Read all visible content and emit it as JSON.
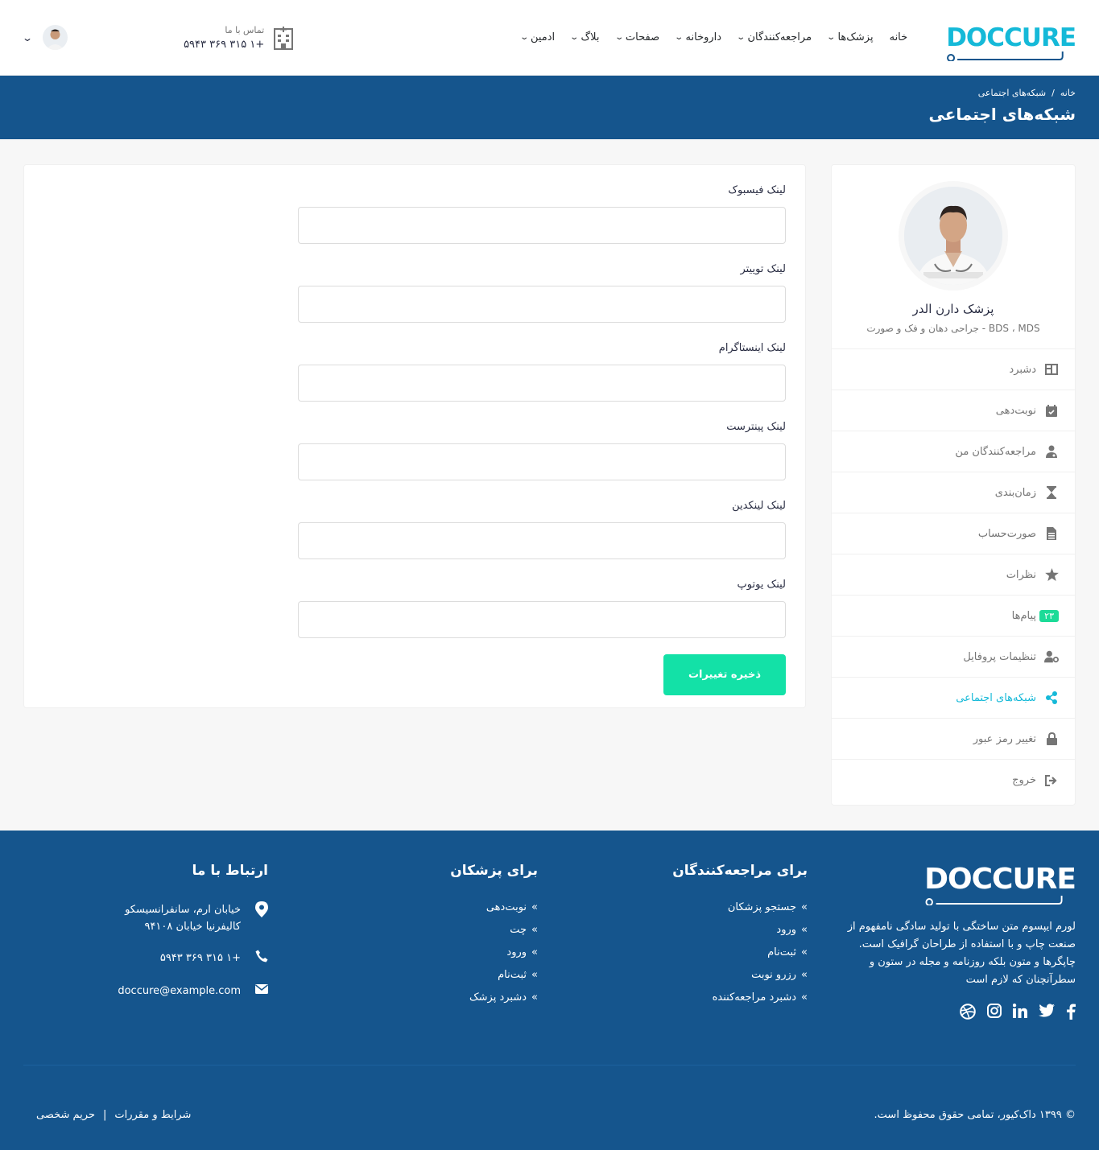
{
  "header": {
    "logo_text": "DOCCURE",
    "nav": [
      {
        "label": "خانه",
        "has_dropdown": false
      },
      {
        "label": "پزشک‌ها",
        "has_dropdown": true
      },
      {
        "label": "مراجعه‌کنندگان",
        "has_dropdown": true
      },
      {
        "label": "داروخانه",
        "has_dropdown": true
      },
      {
        "label": "صفحات",
        "has_dropdown": true
      },
      {
        "label": "بلاگ",
        "has_dropdown": true
      },
      {
        "label": "ادمین",
        "has_dropdown": true
      }
    ],
    "contact_label": "تماس با ما",
    "contact_phone": "+۱ ۳۱۵ ۳۶۹ ۵۹۴۳"
  },
  "breadcrumb": {
    "items": [
      "خانه",
      "/",
      "شبکه‌های اجتماعی"
    ],
    "title": "شبکه‌های اجتماعی"
  },
  "sidebar": {
    "doctor_name": "پزشک دارن الدر",
    "specialty": "BDS ، MDS - جراحی دهان و فک و صورت",
    "menu": [
      {
        "label": "دشبرد",
        "icon": "dashboard-icon"
      },
      {
        "label": "نوبت‌دهی",
        "icon": "calendar-icon"
      },
      {
        "label": "مراجعه‌کنندگان من",
        "icon": "patients-icon"
      },
      {
        "label": "زمان‌بندی",
        "icon": "hourglass-icon"
      },
      {
        "label": "صورت‌حساب",
        "icon": "invoice-icon"
      },
      {
        "label": "نظرات",
        "icon": "star-icon"
      },
      {
        "label": "پیام‌ها",
        "icon": "comments-icon",
        "badge": "۲۳"
      },
      {
        "label": "تنظیمات پروفایل",
        "icon": "user-cog-icon"
      },
      {
        "label": "شبکه‌های اجتماعی",
        "icon": "share-icon",
        "active": true
      },
      {
        "label": "تغییر رمز عبور",
        "icon": "lock-icon"
      },
      {
        "label": "خروج",
        "icon": "sign-out-icon"
      }
    ]
  },
  "form": {
    "fields": [
      {
        "label": "لینک فیسبوک",
        "value": ""
      },
      {
        "label": "لینک توییتر",
        "value": ""
      },
      {
        "label": "لینک اینستاگرام",
        "value": ""
      },
      {
        "label": "لینک پینترست",
        "value": ""
      },
      {
        "label": "لینک لینکدین",
        "value": ""
      },
      {
        "label": "لینک یوتوپ",
        "value": ""
      }
    ],
    "save_label": "ذخیره تغییرات"
  },
  "footer": {
    "logo_text": "DOCCURE",
    "about": "لورم ایپسوم متن ساختگی با تولید سادگی نامفهوم از صنعت چاپ و با استفاده از طراحان گرافیک است. چاپگرها و متون بلکه روزنامه و مجله در ستون و سطرآنچنان که لازم است",
    "patients_title": "برای مراجعه‌کنندگان",
    "patients_links": [
      "جستجو پزشکان",
      "ورود",
      "ثبت‌نام",
      "رزرو نوبت",
      "دشبرد مراجعه‌کننده"
    ],
    "doctors_title": "برای پزشکان",
    "doctors_links": [
      "نوبت‌دهی",
      "چت",
      "ورود",
      "ثبت‌نام",
      "دشبرد پزشک"
    ],
    "contact_title": "ارتباط با ما",
    "address_line1": "خیابان ارم، سانفرانسیسکو",
    "address_line2": "کالیفرنیا خیابان ۹۴۱۰۸",
    "phone": "+۱ ۳۱۵ ۳۶۹ ۵۹۴۳",
    "email": "doccure@example.com",
    "copyright": "© ۱۳۹۹ داک‌کیور، تمامی حقوق محفوظ است.",
    "terms": "شرایط و مقررات",
    "separator": "|",
    "privacy": "حریم شخصی"
  },
  "colors": {
    "primary": "#15558d",
    "accent": "#15b9d8",
    "success": "#13e1a7"
  }
}
